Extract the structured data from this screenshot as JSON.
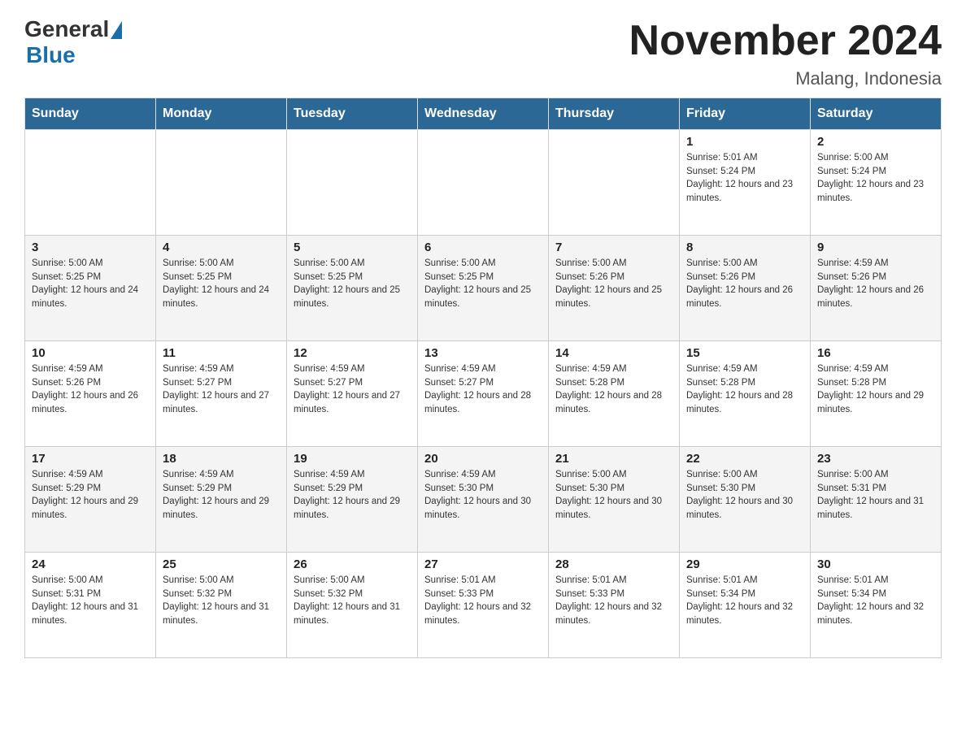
{
  "header": {
    "logo_general": "General",
    "logo_blue": "Blue",
    "title": "November 2024",
    "subtitle": "Malang, Indonesia"
  },
  "days_of_week": [
    "Sunday",
    "Monday",
    "Tuesday",
    "Wednesday",
    "Thursday",
    "Friday",
    "Saturday"
  ],
  "weeks": [
    [
      {
        "day": "",
        "sunrise": "",
        "sunset": "",
        "daylight": "",
        "empty": true
      },
      {
        "day": "",
        "sunrise": "",
        "sunset": "",
        "daylight": "",
        "empty": true
      },
      {
        "day": "",
        "sunrise": "",
        "sunset": "",
        "daylight": "",
        "empty": true
      },
      {
        "day": "",
        "sunrise": "",
        "sunset": "",
        "daylight": "",
        "empty": true
      },
      {
        "day": "",
        "sunrise": "",
        "sunset": "",
        "daylight": "",
        "empty": true
      },
      {
        "day": "1",
        "sunrise": "Sunrise: 5:01 AM",
        "sunset": "Sunset: 5:24 PM",
        "daylight": "Daylight: 12 hours and 23 minutes.",
        "empty": false
      },
      {
        "day": "2",
        "sunrise": "Sunrise: 5:00 AM",
        "sunset": "Sunset: 5:24 PM",
        "daylight": "Daylight: 12 hours and 23 minutes.",
        "empty": false
      }
    ],
    [
      {
        "day": "3",
        "sunrise": "Sunrise: 5:00 AM",
        "sunset": "Sunset: 5:25 PM",
        "daylight": "Daylight: 12 hours and 24 minutes.",
        "empty": false
      },
      {
        "day": "4",
        "sunrise": "Sunrise: 5:00 AM",
        "sunset": "Sunset: 5:25 PM",
        "daylight": "Daylight: 12 hours and 24 minutes.",
        "empty": false
      },
      {
        "day": "5",
        "sunrise": "Sunrise: 5:00 AM",
        "sunset": "Sunset: 5:25 PM",
        "daylight": "Daylight: 12 hours and 25 minutes.",
        "empty": false
      },
      {
        "day": "6",
        "sunrise": "Sunrise: 5:00 AM",
        "sunset": "Sunset: 5:25 PM",
        "daylight": "Daylight: 12 hours and 25 minutes.",
        "empty": false
      },
      {
        "day": "7",
        "sunrise": "Sunrise: 5:00 AM",
        "sunset": "Sunset: 5:26 PM",
        "daylight": "Daylight: 12 hours and 25 minutes.",
        "empty": false
      },
      {
        "day": "8",
        "sunrise": "Sunrise: 5:00 AM",
        "sunset": "Sunset: 5:26 PM",
        "daylight": "Daylight: 12 hours and 26 minutes.",
        "empty": false
      },
      {
        "day": "9",
        "sunrise": "Sunrise: 4:59 AM",
        "sunset": "Sunset: 5:26 PM",
        "daylight": "Daylight: 12 hours and 26 minutes.",
        "empty": false
      }
    ],
    [
      {
        "day": "10",
        "sunrise": "Sunrise: 4:59 AM",
        "sunset": "Sunset: 5:26 PM",
        "daylight": "Daylight: 12 hours and 26 minutes.",
        "empty": false
      },
      {
        "day": "11",
        "sunrise": "Sunrise: 4:59 AM",
        "sunset": "Sunset: 5:27 PM",
        "daylight": "Daylight: 12 hours and 27 minutes.",
        "empty": false
      },
      {
        "day": "12",
        "sunrise": "Sunrise: 4:59 AM",
        "sunset": "Sunset: 5:27 PM",
        "daylight": "Daylight: 12 hours and 27 minutes.",
        "empty": false
      },
      {
        "day": "13",
        "sunrise": "Sunrise: 4:59 AM",
        "sunset": "Sunset: 5:27 PM",
        "daylight": "Daylight: 12 hours and 28 minutes.",
        "empty": false
      },
      {
        "day": "14",
        "sunrise": "Sunrise: 4:59 AM",
        "sunset": "Sunset: 5:28 PM",
        "daylight": "Daylight: 12 hours and 28 minutes.",
        "empty": false
      },
      {
        "day": "15",
        "sunrise": "Sunrise: 4:59 AM",
        "sunset": "Sunset: 5:28 PM",
        "daylight": "Daylight: 12 hours and 28 minutes.",
        "empty": false
      },
      {
        "day": "16",
        "sunrise": "Sunrise: 4:59 AM",
        "sunset": "Sunset: 5:28 PM",
        "daylight": "Daylight: 12 hours and 29 minutes.",
        "empty": false
      }
    ],
    [
      {
        "day": "17",
        "sunrise": "Sunrise: 4:59 AM",
        "sunset": "Sunset: 5:29 PM",
        "daylight": "Daylight: 12 hours and 29 minutes.",
        "empty": false
      },
      {
        "day": "18",
        "sunrise": "Sunrise: 4:59 AM",
        "sunset": "Sunset: 5:29 PM",
        "daylight": "Daylight: 12 hours and 29 minutes.",
        "empty": false
      },
      {
        "day": "19",
        "sunrise": "Sunrise: 4:59 AM",
        "sunset": "Sunset: 5:29 PM",
        "daylight": "Daylight: 12 hours and 29 minutes.",
        "empty": false
      },
      {
        "day": "20",
        "sunrise": "Sunrise: 4:59 AM",
        "sunset": "Sunset: 5:30 PM",
        "daylight": "Daylight: 12 hours and 30 minutes.",
        "empty": false
      },
      {
        "day": "21",
        "sunrise": "Sunrise: 5:00 AM",
        "sunset": "Sunset: 5:30 PM",
        "daylight": "Daylight: 12 hours and 30 minutes.",
        "empty": false
      },
      {
        "day": "22",
        "sunrise": "Sunrise: 5:00 AM",
        "sunset": "Sunset: 5:30 PM",
        "daylight": "Daylight: 12 hours and 30 minutes.",
        "empty": false
      },
      {
        "day": "23",
        "sunrise": "Sunrise: 5:00 AM",
        "sunset": "Sunset: 5:31 PM",
        "daylight": "Daylight: 12 hours and 31 minutes.",
        "empty": false
      }
    ],
    [
      {
        "day": "24",
        "sunrise": "Sunrise: 5:00 AM",
        "sunset": "Sunset: 5:31 PM",
        "daylight": "Daylight: 12 hours and 31 minutes.",
        "empty": false
      },
      {
        "day": "25",
        "sunrise": "Sunrise: 5:00 AM",
        "sunset": "Sunset: 5:32 PM",
        "daylight": "Daylight: 12 hours and 31 minutes.",
        "empty": false
      },
      {
        "day": "26",
        "sunrise": "Sunrise: 5:00 AM",
        "sunset": "Sunset: 5:32 PM",
        "daylight": "Daylight: 12 hours and 31 minutes.",
        "empty": false
      },
      {
        "day": "27",
        "sunrise": "Sunrise: 5:01 AM",
        "sunset": "Sunset: 5:33 PM",
        "daylight": "Daylight: 12 hours and 32 minutes.",
        "empty": false
      },
      {
        "day": "28",
        "sunrise": "Sunrise: 5:01 AM",
        "sunset": "Sunset: 5:33 PM",
        "daylight": "Daylight: 12 hours and 32 minutes.",
        "empty": false
      },
      {
        "day": "29",
        "sunrise": "Sunrise: 5:01 AM",
        "sunset": "Sunset: 5:34 PM",
        "daylight": "Daylight: 12 hours and 32 minutes.",
        "empty": false
      },
      {
        "day": "30",
        "sunrise": "Sunrise: 5:01 AM",
        "sunset": "Sunset: 5:34 PM",
        "daylight": "Daylight: 12 hours and 32 minutes.",
        "empty": false
      }
    ]
  ]
}
